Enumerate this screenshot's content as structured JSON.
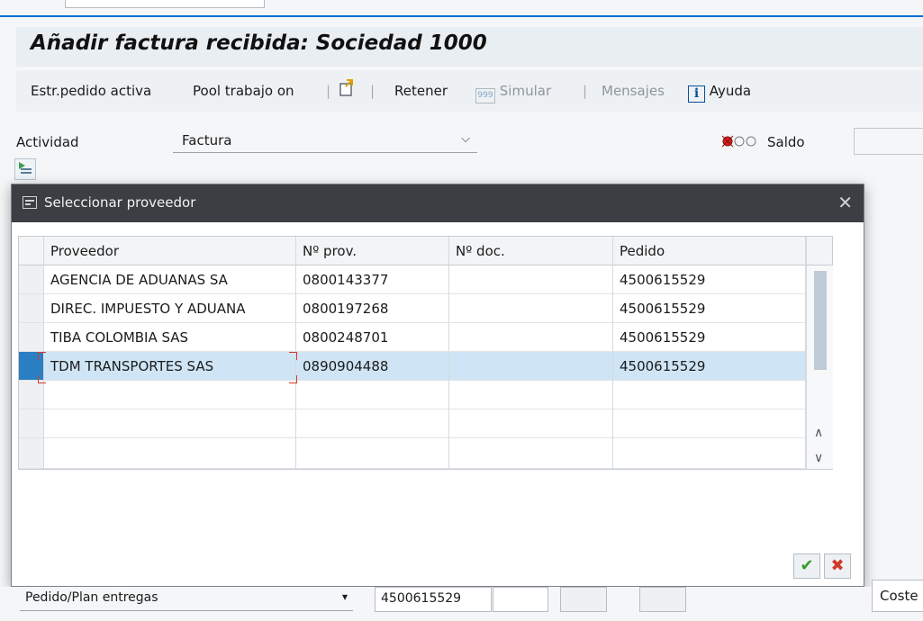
{
  "header": {
    "title": "Añadir factura recibida: Sociedad 1000"
  },
  "toolbar": {
    "estr_pedido": "Estr.pedido activa",
    "pool_trabajo": "Pool trabajo on",
    "retener": "Retener",
    "simular": "Simular",
    "mensajes": "Mensajes",
    "ayuda": "Ayuda"
  },
  "form": {
    "actividad_label": "Actividad",
    "actividad_value": "Factura",
    "saldo_label": "Saldo",
    "status_light": "red"
  },
  "dialog": {
    "title": "Seleccionar proveedor",
    "columns": [
      "Proveedor",
      "Nº prov.",
      "Nº doc.",
      "Pedido"
    ],
    "rows": [
      [
        "AGENCIA DE ADUANAS SA",
        "0800143377",
        "",
        "4500615529"
      ],
      [
        "DIREC. IMPUESTO Y ADUANA",
        "0800197268",
        "",
        "4500615529"
      ],
      [
        "TIBA COLOMBIA SAS",
        "0800248701",
        "",
        "4500615529"
      ],
      [
        "TDM TRANSPORTES SAS",
        "0890904488",
        "",
        "4500615529"
      ]
    ],
    "selected_row": 3,
    "confirm_icon": "checkmark-icon",
    "cancel_icon": "cancel-x-icon"
  },
  "bottom": {
    "reference_type": "Pedido/Plan entregas",
    "po_number": "4500615529",
    "right_field": "Coste"
  },
  "colors": {
    "accent": "#0a6ed1",
    "dialog_header": "#3b3f43",
    "selection": "#cfe5f5",
    "selection_marker": "#2a7fc3"
  }
}
